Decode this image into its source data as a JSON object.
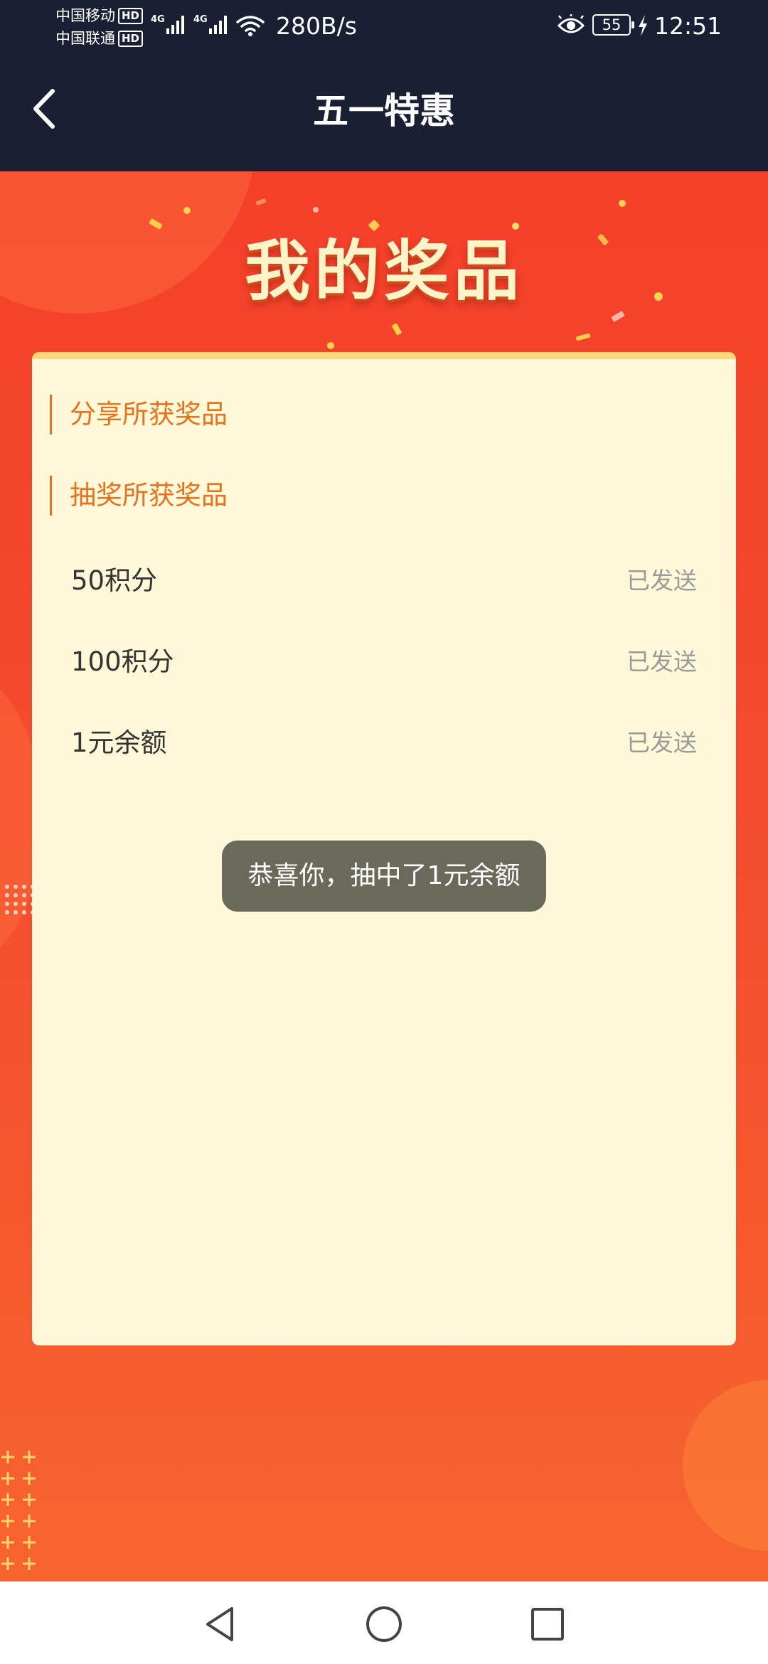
{
  "status_bar": {
    "carriers": [
      {
        "name": "中国移动",
        "badge": "HD"
      },
      {
        "name": "中国联通",
        "badge": "HD"
      }
    ],
    "network_tags": [
      "4G",
      "4G"
    ],
    "net_speed": "280B/s",
    "battery": "55",
    "time": "12:51"
  },
  "title_bar": {
    "title": "五一特惠"
  },
  "banner": {
    "heading": "我的奖品"
  },
  "sections": {
    "share": "分享所获奖品",
    "lottery": "抽奖所获奖品"
  },
  "prizes": [
    {
      "name": "50积分",
      "status": "已发送"
    },
    {
      "name": "100积分",
      "status": "已发送"
    },
    {
      "name": "1元余额",
      "status": "已发送"
    }
  ],
  "toast": {
    "message": "恭喜你，抽中了1元余额"
  },
  "colors": {
    "header_bg": "#1b1f33",
    "stage_red": "#f5402a",
    "card_bg": "#fff8d9",
    "section_orange": "#e8721c",
    "status_gray": "#9a9a9a"
  },
  "icons": {
    "back": "chevron-left-icon",
    "nav_back": "triangle-back-icon",
    "nav_home": "circle-home-icon",
    "nav_recent": "square-recent-icon"
  }
}
